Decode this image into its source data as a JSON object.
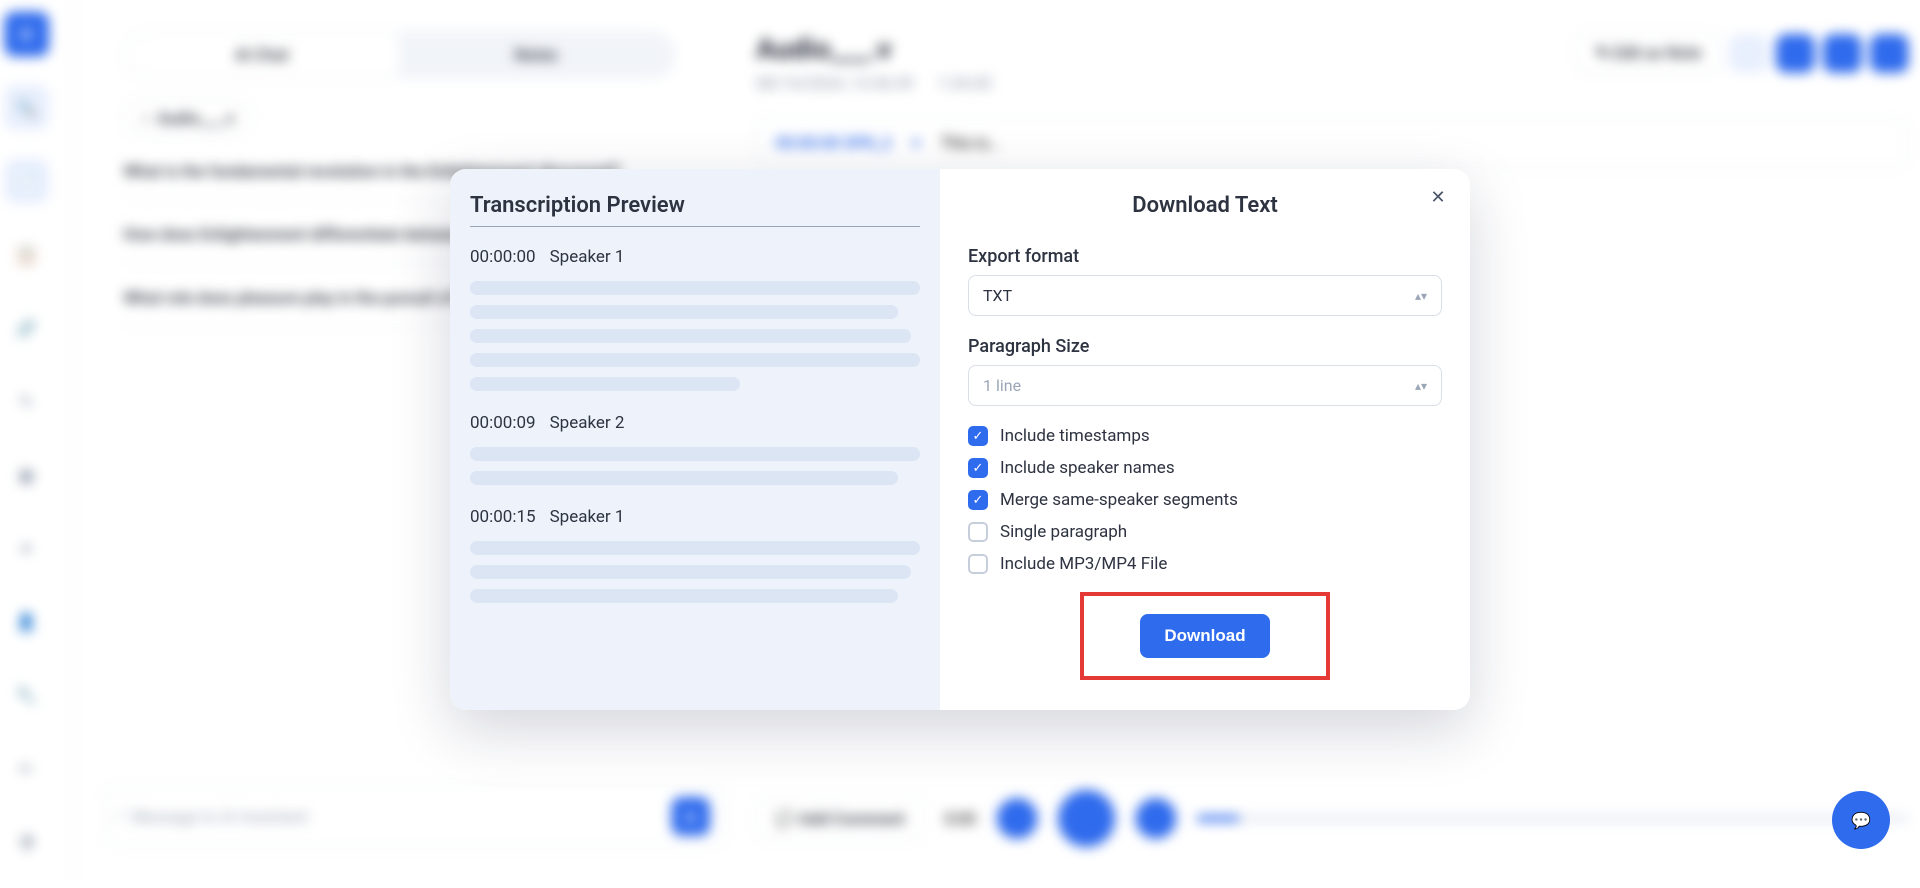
{
  "sidebar": {
    "logo_letter": "U"
  },
  "left": {
    "tab_ai": "AI Chat",
    "tab_notes": "Notes",
    "crumb": "Audio___.v",
    "q1": "What is the fundamental revolution in the Enlightenment discussed?",
    "q2": "How does Enlightenment differentiate between the meaning of life?",
    "q3": "What role does pleasure play in the pursuit of Enlightenment?",
    "input_placeholder": "Message to AI Assistant"
  },
  "right": {
    "title": "Audio___.v",
    "meta_date": "08/14/2024, 13:36:39",
    "meta_duration": "1:34:45",
    "edit": "Edit as Note",
    "spk_label": "00:00:00   SPK_2",
    "this_is": "This is…",
    "add_comment": "Add Comment",
    "time": "0:00"
  },
  "modal": {
    "preview_title": "Transcription Preview",
    "title": "Download Text",
    "export_label": "Export format",
    "export_value": "TXT",
    "para_label": "Paragraph Size",
    "para_value": "1 line",
    "segments": [
      {
        "time": "00:00:00",
        "speaker": "Speaker 1",
        "bars": [
          "w100",
          "w95",
          "w98",
          "w100",
          "w60"
        ]
      },
      {
        "time": "00:00:09",
        "speaker": "Speaker 2",
        "bars": [
          "w100",
          "w95"
        ]
      },
      {
        "time": "00:00:15",
        "speaker": "Speaker 1",
        "bars": [
          "w100",
          "w98",
          "w95"
        ]
      }
    ],
    "checks": [
      {
        "label": "Include timestamps",
        "checked": true
      },
      {
        "label": "Include speaker names",
        "checked": true
      },
      {
        "label": "Merge same-speaker segments",
        "checked": true
      },
      {
        "label": "Single paragraph",
        "checked": false
      },
      {
        "label": "Include MP3/MP4 File",
        "checked": false
      }
    ],
    "download": "Download",
    "highlight_download": true
  }
}
